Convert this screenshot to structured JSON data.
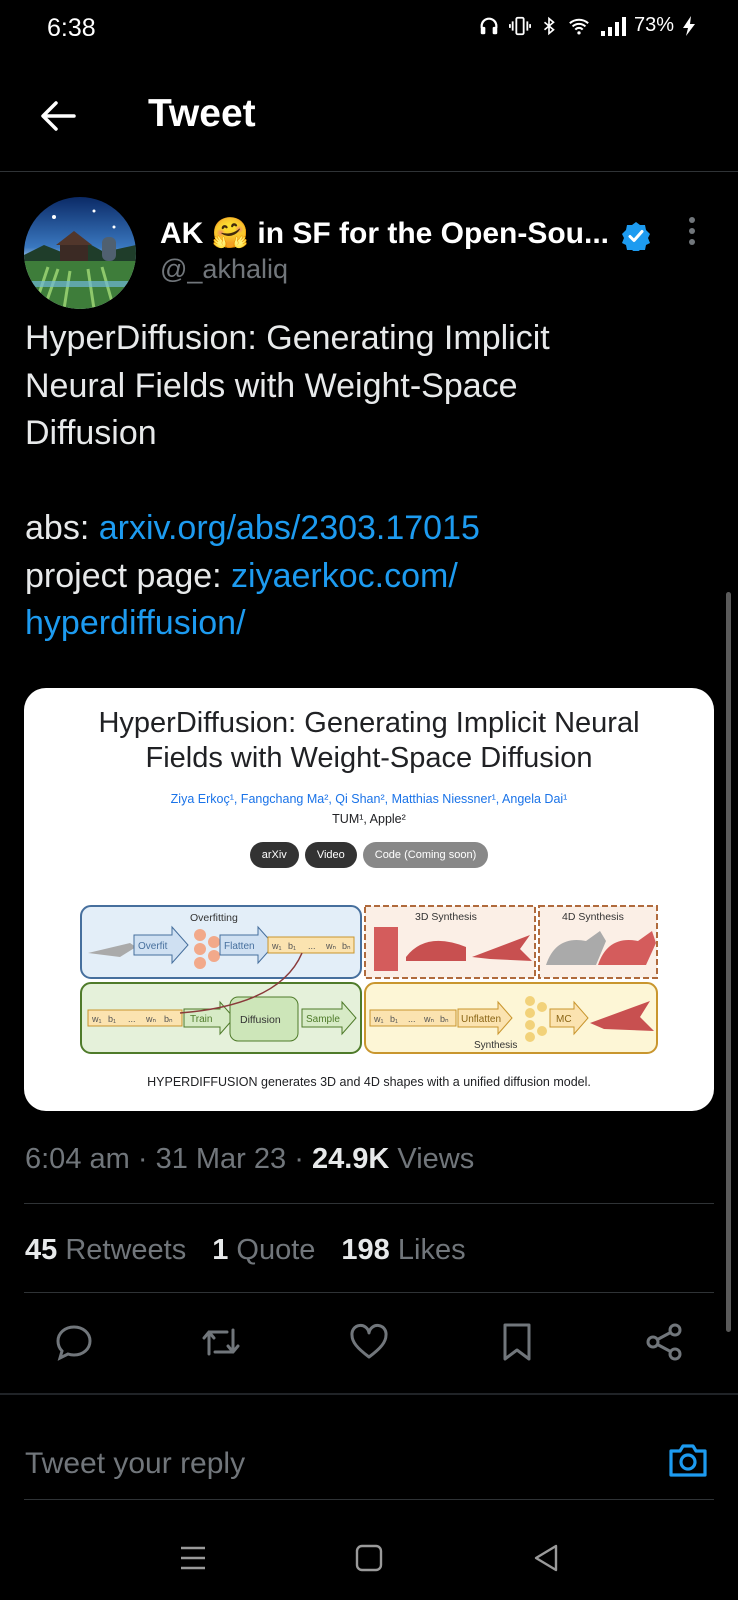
{
  "status_bar": {
    "time": "6:38",
    "battery": "73%"
  },
  "header": {
    "title": "Tweet"
  },
  "author": {
    "name": "AK 🤗 in SF for the Open-Sou...",
    "handle": "@_akhaliq"
  },
  "tweet": {
    "text_line1": "HyperDiffusion: Generating Implicit",
    "text_line2": "Neural Fields with Weight-Space",
    "text_line3": "Diffusion",
    "abs_label": "abs: ",
    "abs_link": "arxiv.org/abs/2303.17015",
    "project_label": "project page: ",
    "project_link_1": "ziyaerkoc.com/",
    "project_link_2": "hyperdiffusion/"
  },
  "media": {
    "title_line1": "HyperDiffusion: Generating Implicit Neural",
    "title_line2": "Fields with Weight-Space Diffusion",
    "authors": "Ziya Erkoç¹, Fangchang Ma², Qi Shan², Matthias Niessner¹, Angela Dai¹",
    "affiliations": "TUM¹, Apple²",
    "buttons": [
      "arXiv",
      "Video",
      "Code (Coming soon)"
    ],
    "diagram": {
      "overfitting": "Overfitting",
      "overfit": "Overfit",
      "flatten": "Flatten",
      "synthesis_3d": "3D Synthesis",
      "synthesis_4d": "4D Synthesis",
      "train": "Train",
      "diffusion": "Diffusion",
      "sample": "Sample",
      "unflatten": "Unflatten",
      "mc": "MC",
      "synthesis": "Synthesis",
      "w1": "w₁",
      "b1": "b₁",
      "dots": "...",
      "wn": "wₙ",
      "bn": "bₙ"
    },
    "caption": "HYPERDIFFUSION generates 3D and 4D shapes with a unified diffusion model."
  },
  "meta": {
    "time": "6:04 am",
    "date": "31 Mar 23",
    "views_count": "24.9K",
    "views_label": "Views"
  },
  "stats": {
    "retweets_count": "45",
    "retweets_label": "Retweets",
    "quotes_count": "1",
    "quotes_label": "Quote",
    "likes_count": "198",
    "likes_label": "Likes"
  },
  "reply": {
    "placeholder": "Tweet your reply"
  },
  "colors": {
    "link": "#1d9bf0",
    "background": "#000000",
    "muted": "#71767b"
  }
}
